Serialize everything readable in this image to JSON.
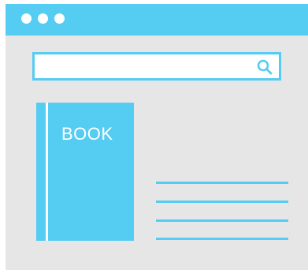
{
  "colors": {
    "accent": "#55ccf2",
    "background": "#e6e6e6",
    "surface": "#ffffff"
  },
  "titlebar": {
    "controls": [
      "window-dot",
      "window-dot",
      "window-dot"
    ]
  },
  "search": {
    "value": "",
    "placeholder": "",
    "icon": "search-icon"
  },
  "book": {
    "label": "BOOK"
  },
  "text_lines": 4
}
